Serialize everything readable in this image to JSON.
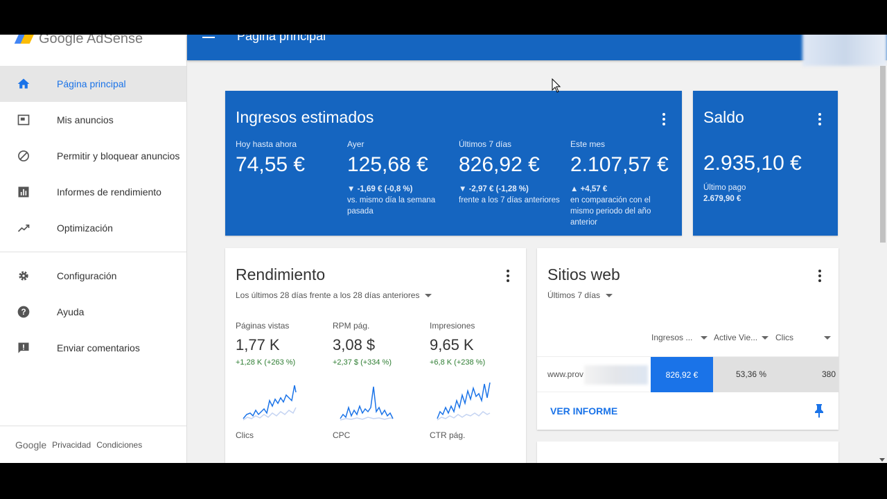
{
  "app": {
    "logo_text": "Google AdSense",
    "page_title": "Página principal"
  },
  "colors": {
    "primary": "#1565c0",
    "accent": "#1a73e8",
    "positive": "#2e7d32"
  },
  "sidebar": {
    "items": [
      {
        "label": "Página principal",
        "icon": "home-icon",
        "active": true
      },
      {
        "label": "Mis anuncios",
        "icon": "ad-unit-icon"
      },
      {
        "label": "Permitir y bloquear anuncios",
        "icon": "block-icon"
      },
      {
        "label": "Informes de rendimiento",
        "icon": "bar-chart-icon"
      },
      {
        "label": "Optimización",
        "icon": "trending-up-icon"
      },
      {
        "label": "Configuración",
        "icon": "gear-icon"
      },
      {
        "label": "Ayuda",
        "icon": "help-icon"
      },
      {
        "label": "Enviar comentarios",
        "icon": "feedback-icon"
      }
    ],
    "footer": {
      "google": "Google",
      "privacy": "Privacidad",
      "terms": "Condiciones"
    }
  },
  "estimated": {
    "title": "Ingresos estimados",
    "metrics": [
      {
        "label": "Hoy hasta ahora",
        "value": "74,55 €",
        "delta": "",
        "note": ""
      },
      {
        "label": "Ayer",
        "value": "125,68 €",
        "delta": "▼ -1,69 € (-0,8 %)",
        "note": "vs. mismo día la semana pasada"
      },
      {
        "label": "Últimos 7 días",
        "value": "826,92 €",
        "delta": "▼ -2,97 € (-1,28 %)",
        "note": "frente a los 7 días anteriores"
      },
      {
        "label": "Este mes",
        "value": "2.107,57 €",
        "delta": "▲ +4,57 €",
        "note": "en comparación con el mismo periodo del año anterior"
      }
    ]
  },
  "balance": {
    "title": "Saldo",
    "value": "2.935,10 €",
    "last_label": "Último pago",
    "last_value": "2.679,90 €"
  },
  "performance": {
    "title": "Rendimiento",
    "range": "Los últimos 28 días frente a los 28 días anteriores",
    "metrics": [
      {
        "label": "Páginas vistas",
        "value": "1,77 K",
        "delta": "+1,28 K (+263 %)"
      },
      {
        "label": "RPM pág.",
        "value": "3,08 $",
        "delta": "+2,37 $ (+334 %)"
      },
      {
        "label": "Impresiones",
        "value": "9,65 K",
        "delta": "+6,8 K (+238 %)"
      }
    ],
    "row2": [
      {
        "label": "Clics"
      },
      {
        "label": "CPC"
      },
      {
        "label": "CTR pág."
      }
    ]
  },
  "sites": {
    "title": "Sitios web",
    "range": "Últimos 7 días",
    "columns": [
      "Ingresos ...",
      "Active Vie...",
      "Clics"
    ],
    "row": {
      "site": "www.prov",
      "earnings": "826,92 €",
      "active_view": "53,36 %",
      "clicks": "380"
    },
    "link": "VER INFORME"
  }
}
